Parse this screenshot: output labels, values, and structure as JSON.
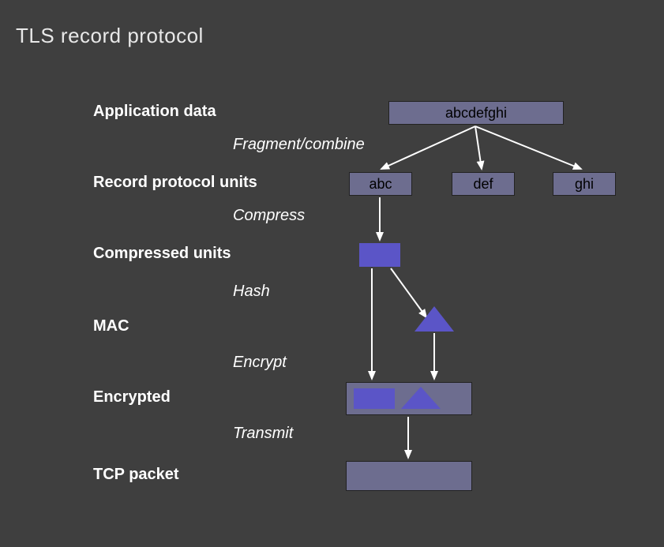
{
  "title": "TLS record protocol",
  "rows": {
    "app_data": "Application data",
    "rpu": "Record protocol units",
    "compressed": "Compressed units",
    "mac": "MAC",
    "encrypted": "Encrypted",
    "tcp": "TCP packet"
  },
  "steps": {
    "fragment": "Fragment/combine",
    "compress": "Compress",
    "hash": "Hash",
    "encrypt": "Encrypt",
    "transmit": "Transmit"
  },
  "data": {
    "full": "abcdefghi",
    "frag1": "abc",
    "frag2": "def",
    "frag3": "ghi"
  }
}
